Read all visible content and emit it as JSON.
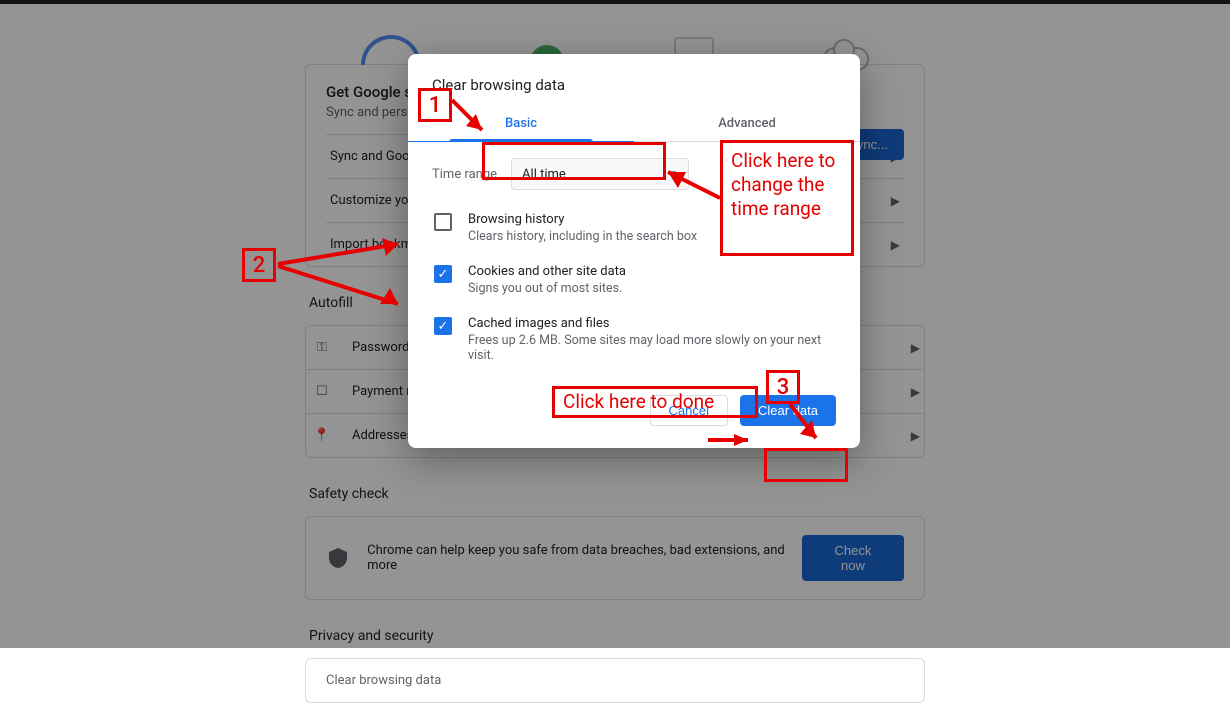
{
  "hero": {
    "title": "Get Google smarts in Chrome",
    "sub": "Sync and personalize Chrome across your devices",
    "button": "Turn on sync..."
  },
  "hero_rows": [
    "Sync and Google services",
    "Customize your Chrome profile",
    "Import bookmarks and settings"
  ],
  "autofill": {
    "heading": "Autofill",
    "rows": [
      "Passwords",
      "Payment methods",
      "Addresses and more"
    ]
  },
  "safety": {
    "heading": "Safety check",
    "text": "Chrome can help keep you safe from data breaches, bad extensions, and more",
    "button": "Check now"
  },
  "privacy": {
    "heading": "Privacy and security",
    "row": "Clear browsing data"
  },
  "dialog": {
    "title": "Clear browsing data",
    "tabs": {
      "basic": "Basic",
      "advanced": "Advanced"
    },
    "time_label": "Time range",
    "time_value": "All time",
    "items": [
      {
        "title": "Browsing history",
        "sub": "Clears history, including in the search box",
        "checked": false
      },
      {
        "title": "Cookies and other site data",
        "sub": "Signs you out of most sites.",
        "checked": true
      },
      {
        "title": "Cached images and files",
        "sub": "Frees up 2.6 MB. Some sites may load more slowly on your next visit.",
        "checked": true
      }
    ],
    "cancel": "Cancel",
    "confirm": "Clear data"
  },
  "anno": {
    "n1": "1",
    "n2": "2",
    "n3": "3",
    "time_tip": "Click here to change the time range",
    "done_tip": "Click here to done"
  }
}
